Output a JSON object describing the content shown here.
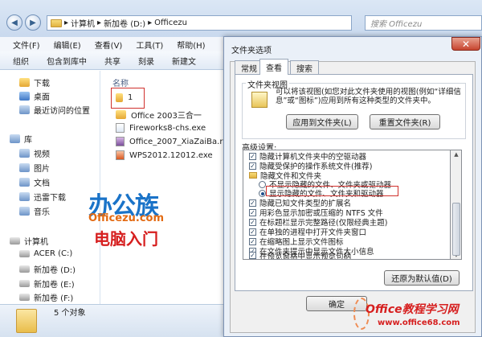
{
  "explorer": {
    "breadcrumb": [
      "计算机",
      "新加卷 (D:)",
      "Officezu"
    ],
    "search_placeholder": "搜索 Officezu",
    "menu": [
      "文件(F)",
      "编辑(E)",
      "查看(V)",
      "工具(T)",
      "帮助(H)"
    ],
    "toolbar": [
      "组织",
      "包含到库中",
      "共享",
      "刻录",
      "新建文"
    ],
    "column_header": "名称",
    "files": [
      "1",
      "Office 2003三合一",
      "Fireworks8-chs.exe",
      "Office_2007_XiaZaiBa.rar",
      "WPS2012.12012.exe"
    ],
    "sidebar": {
      "favorites": [
        "下载",
        "桌面",
        "最近访问的位置"
      ],
      "library": "库",
      "library_items": [
        "视频",
        "图片",
        "文档",
        "迅雷下载",
        "音乐"
      ],
      "computer": "计算机",
      "drives": [
        "ACER (C:)",
        "新加卷 (D:)",
        "新加卷 (E:)",
        "新加卷 (F:)"
      ]
    },
    "status": "5 个对象"
  },
  "watermark": {
    "brand": "办公族",
    "site": "Officezu.com",
    "slogan": "电脑入门",
    "brand2": "Office教程学习网",
    "site2": "www.office68.com"
  },
  "dialog": {
    "title": "文件夹选项",
    "close": "✕",
    "tabs": [
      "常规",
      "查看",
      "搜索"
    ],
    "active_tab": 1,
    "folder_view": {
      "title": "文件夹视图",
      "description": "可以将该视图(如您对此文件夹使用的视图(例如“详细信息”或“图标”)应用到所有这种类型的文件夹中。",
      "apply_button": "应用到文件夹(L)",
      "reset_button": "重置文件夹(R)"
    },
    "advanced_label": "高级设置:",
    "options": [
      {
        "type": "check",
        "checked": true,
        "label": "隐藏计算机文件夹中的空驱动器"
      },
      {
        "type": "check",
        "checked": true,
        "label": "隐藏受保护的操作系统文件(推荐)"
      },
      {
        "type": "folder",
        "label": "隐藏文件和文件夹"
      },
      {
        "type": "radio",
        "checked": false,
        "label": "不显示隐藏的文件、文件夹或驱动器"
      },
      {
        "type": "radio",
        "checked": true,
        "label": "显示隐藏的文件、文件夹和驱动器"
      },
      {
        "type": "check",
        "checked": true,
        "label": "隐藏已知文件类型的扩展名"
      },
      {
        "type": "check",
        "checked": true,
        "label": "用彩色显示加密或压缩的 NTFS 文件"
      },
      {
        "type": "check",
        "checked": true,
        "label": "在标题栏显示完整路径(仅限经典主题)"
      },
      {
        "type": "check",
        "checked": true,
        "label": "在单独的进程中打开文件夹窗口"
      },
      {
        "type": "check",
        "checked": true,
        "label": "在缩略图上显示文件图标"
      },
      {
        "type": "check",
        "checked": true,
        "label": "在文件夹提示中显示文件大小信息"
      },
      {
        "type": "check",
        "checked": true,
        "label": "在预览窗格中显示预览句柄"
      }
    ],
    "restore_button": "还原为默认值(D)",
    "ok_button": "确定",
    "cancel_button": "取消"
  }
}
